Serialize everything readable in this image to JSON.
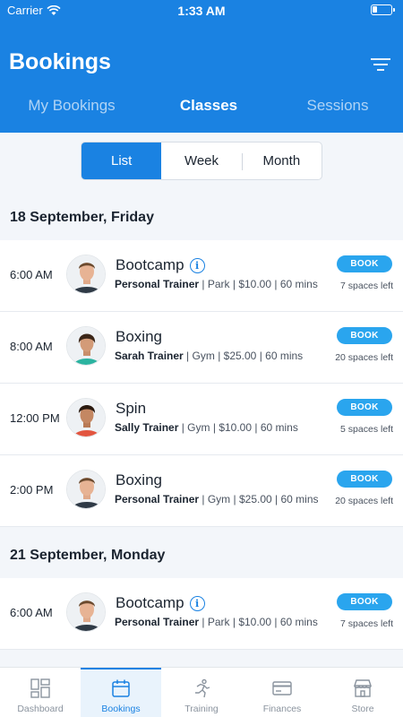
{
  "status_bar": {
    "carrier": "Carrier",
    "time": "1:33 AM"
  },
  "header": {
    "title": "Bookings"
  },
  "tabs": [
    {
      "label": "My Bookings",
      "active": false
    },
    {
      "label": "Classes",
      "active": true
    },
    {
      "label": "Sessions",
      "active": false
    }
  ],
  "view_toggle": [
    {
      "label": "List",
      "active": true
    },
    {
      "label": "Week",
      "active": false
    },
    {
      "label": "Month",
      "active": false
    }
  ],
  "days": [
    {
      "date": "18 September, Friday",
      "classes": [
        {
          "time": "6:00 AM",
          "name": "Bootcamp",
          "info": true,
          "trainer": "Personal Trainer",
          "location": "Park",
          "price": "$10.00",
          "duration": "60 mins",
          "book_label": "BOOK",
          "spaces": "7 spaces left",
          "avatar": "male-trainer-avatar"
        },
        {
          "time": "8:00 AM",
          "name": "Boxing",
          "info": false,
          "trainer": "Sarah Trainer",
          "location": "Gym",
          "price": "$25.00",
          "duration": "60 mins",
          "book_label": "BOOK",
          "spaces": "20 spaces left",
          "avatar": "female-trainer-avatar"
        },
        {
          "time": "12:00 PM",
          "name": "Spin",
          "info": false,
          "trainer": "Sally Trainer",
          "location": "Gym",
          "price": "$10.00",
          "duration": "60 mins",
          "book_label": "BOOK",
          "spaces": "5 spaces left",
          "avatar": "female-trainer-avatar"
        },
        {
          "time": "2:00 PM",
          "name": "Boxing",
          "info": false,
          "trainer": "Personal Trainer",
          "location": "Gym",
          "price": "$25.00",
          "duration": "60 mins",
          "book_label": "BOOK",
          "spaces": "20 spaces left",
          "avatar": "male-trainer-avatar"
        }
      ]
    },
    {
      "date": "21 September, Monday",
      "classes": [
        {
          "time": "6:00 AM",
          "name": "Bootcamp",
          "info": true,
          "trainer": "Personal Trainer",
          "location": "Park",
          "price": "$10.00",
          "duration": "60 mins",
          "book_label": "BOOK",
          "spaces": "7 spaces left",
          "avatar": "male-trainer-avatar"
        }
      ]
    }
  ],
  "bottom_nav": [
    {
      "label": "Dashboard",
      "icon": "dashboard-icon",
      "active": false
    },
    {
      "label": "Bookings",
      "icon": "calendar-icon",
      "active": true
    },
    {
      "label": "Training",
      "icon": "running-icon",
      "active": false
    },
    {
      "label": "Finances",
      "icon": "credit-card-icon",
      "active": false
    },
    {
      "label": "Store",
      "icon": "store-icon",
      "active": false
    }
  ],
  "colors": {
    "primary": "#1a82e2",
    "book_button": "#2aa5ee",
    "background": "#f3f6fa"
  }
}
